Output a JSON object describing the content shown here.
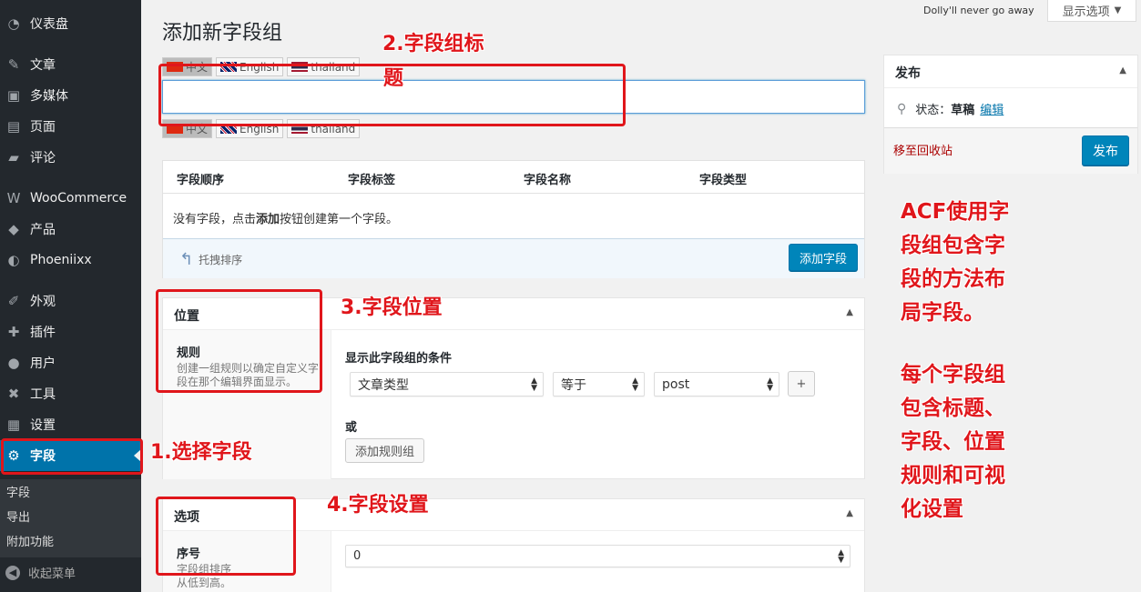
{
  "sidebar": {
    "items": [
      {
        "label": "仪表盘",
        "icon": "dashboard-icon",
        "glyph": "◔"
      },
      {
        "label": "文章",
        "icon": "pin-icon",
        "glyph": "✎"
      },
      {
        "label": "多媒体",
        "icon": "media-icon",
        "glyph": "▣"
      },
      {
        "label": "页面",
        "icon": "page-icon",
        "glyph": "▤"
      },
      {
        "label": "评论",
        "icon": "comment-icon",
        "glyph": "▰"
      },
      {
        "label": "WooCommerce",
        "icon": "woocommerce-icon",
        "glyph": "W"
      },
      {
        "label": "产品",
        "icon": "product-icon",
        "glyph": "◆"
      },
      {
        "label": "Phoeniixx",
        "icon": "phoeniixx-icon",
        "glyph": "◐"
      },
      {
        "label": "外观",
        "icon": "appearance-icon",
        "glyph": "✐"
      },
      {
        "label": "插件",
        "icon": "plugin-icon",
        "glyph": "✚"
      },
      {
        "label": "用户",
        "icon": "user-icon",
        "glyph": "●"
      },
      {
        "label": "工具",
        "icon": "tools-icon",
        "glyph": "✖"
      },
      {
        "label": "设置",
        "icon": "settings-icon",
        "glyph": "▦"
      },
      {
        "label": "字段",
        "icon": "gear-icon",
        "glyph": "⚙"
      }
    ],
    "submenu": [
      "字段",
      "导出",
      "附加功能"
    ],
    "collapse": "收起菜单"
  },
  "topbar": {
    "dolly": "Dolly'll never go away",
    "screen_options": "显示选项"
  },
  "page_title": "添加新字段组",
  "languages": [
    "中文",
    "English",
    "thailand"
  ],
  "fields_table": {
    "headers": [
      "字段顺序",
      "字段标签",
      "字段名称",
      "字段类型"
    ],
    "empty_prefix": "没有字段，点击",
    "empty_bold": "添加",
    "empty_suffix": "按钮创建第一个字段。",
    "drag_sort": "托拽排序",
    "add_field": "添加字段"
  },
  "location": {
    "title": "位置",
    "rules_label": "规则",
    "rules_desc": "创建一组规则以确定自定义字段在那个编辑界面显示。",
    "condition_label": "显示此字段组的条件",
    "param": "文章类型",
    "operator": "等于",
    "value": "post",
    "add_btn": "+",
    "or_label": "或",
    "add_group": "添加规则组"
  },
  "options": {
    "title": "选项",
    "order_label": "序号",
    "order_desc": "字段组排序\n从低到高。",
    "order_value": "0"
  },
  "publish": {
    "title": "发布",
    "status_label": "状态：",
    "status_value": "草稿",
    "edit": "编辑",
    "trash": "移至回收站",
    "publish_btn": "发布"
  },
  "annotations": {
    "a1": "1.选择字段",
    "a2_line1": "2.字段组标",
    "a2_line2": "题",
    "a3": "3.字段位置",
    "a4": "4.字段设置",
    "note1": [
      "ACF使用字",
      "段组包含字",
      "段的方法布",
      "局字段。"
    ],
    "note2": [
      "每个字段组",
      "包含标题、",
      "字段、位置",
      "规则和可视",
      "化设置"
    ]
  },
  "colors": {
    "sidebar_bg": "#23282d",
    "active": "#0073aa",
    "annotation": "#e0161b",
    "primary_button": "#0085ba"
  }
}
